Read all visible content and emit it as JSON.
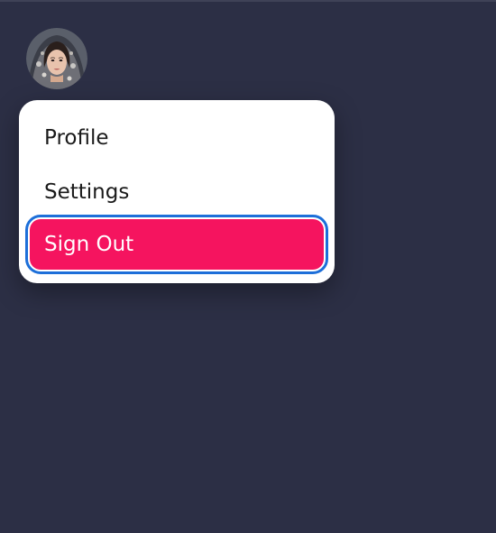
{
  "user": {
    "avatar_alt": "User avatar"
  },
  "menu": {
    "items": [
      {
        "label": "Profile"
      },
      {
        "label": "Settings"
      },
      {
        "label": "Sign Out"
      }
    ]
  },
  "colors": {
    "background": "#2c2f45",
    "menu_background": "#ffffff",
    "accent": "#f5145f",
    "focus_ring": "#1d6fd9"
  }
}
